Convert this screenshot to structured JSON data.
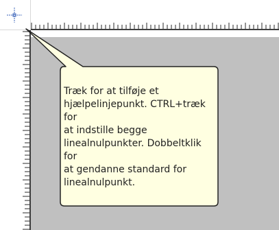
{
  "colors": {
    "tooltip_background": "#ffffe1",
    "tooltip_border": "#222222",
    "canvas_background": "#c0c0c0",
    "ruler_tick": "#2a2a2a",
    "origin_marker": "#3a63b8"
  },
  "ruler": {
    "origin_icon": "ruler-origin-crosshair-icon"
  },
  "tooltip": {
    "text": "Træk for at tilføje et\nhjælpelinjepunkt. CTRL+træk for\nat indstille begge\nlinealnulpunkter. Dobbeltklik for\nat gendanne standard for\nlinealnulpunkt."
  }
}
